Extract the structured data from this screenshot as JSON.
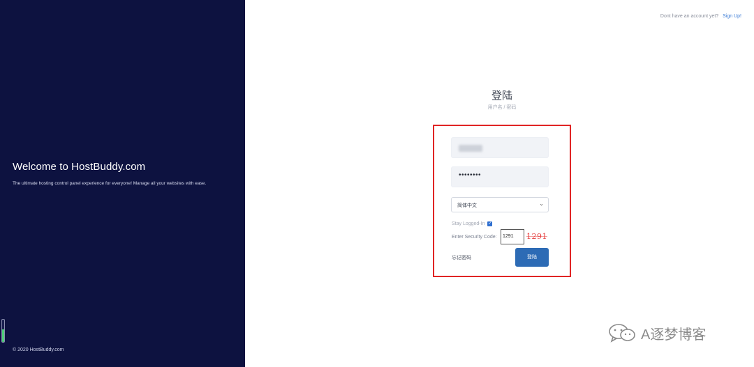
{
  "left": {
    "welcome_title": "Welcome to HostBuddy.com",
    "welcome_sub": "The ultimate hosting control panel experience for everyone! Manage all your websites with ease.",
    "copyright": "© 2020 HostBuddy.com",
    "level_meter_fraction": 0.55
  },
  "topbar": {
    "prompt": "Dont have an account yet?",
    "signup": "Sign Up!"
  },
  "login": {
    "title": "登陆",
    "subtitle": "用户名 / 密码",
    "password_dots": "••••••••",
    "language_selected": "简体中文",
    "stay_logged_in": "Stay Logged-In",
    "stay_checked": true,
    "security_label": "Enter Security Code:",
    "security_value": "1291",
    "captcha": "1291",
    "forgot": "忘记密码",
    "login_button": "登陆"
  },
  "watermark": {
    "text": "A逐梦博客",
    "icon": "wechat-icon"
  },
  "colors": {
    "sidebar_bg": "#0d1240",
    "highlight_border": "#e02424",
    "button_bg": "#2d6bb5",
    "link": "#3a7bd5"
  }
}
